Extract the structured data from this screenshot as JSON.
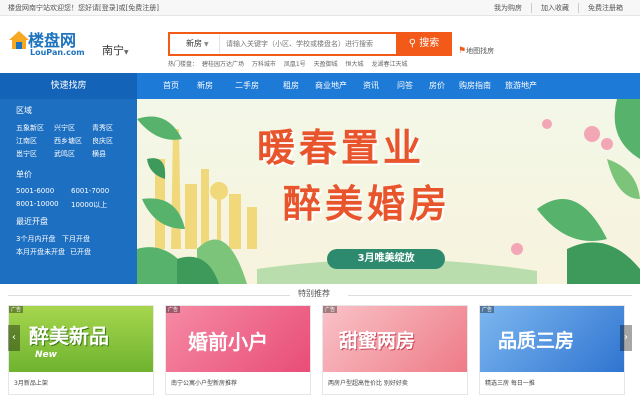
{
  "topbar": {
    "welcome": "楼盘网南宁站欢迎您！",
    "login": "您好请[登录]或[免费注册]",
    "links": [
      "我为购房",
      "加入收藏",
      "免费注册箱"
    ]
  },
  "header": {
    "logo_cn": "楼盘网",
    "logo_en": "LouPan.com",
    "city": "南宁",
    "search_type": "新房",
    "search_placeholder": "请输入关键字（小区、学校或楼盘名）进行搜索",
    "search_button": "搜索",
    "hot_label": "热门楼盘：",
    "hot_words": [
      "碧桂园万达广场",
      "万科城市",
      "凤凰1号",
      "天盈御城",
      "恒大城",
      "龙湖春江天城"
    ],
    "map_find": "地图找房"
  },
  "nav": {
    "quick": "快速找房",
    "items": [
      "首页",
      "新房",
      "二手房",
      "租房",
      "商业地产",
      "资讯",
      "问答",
      "房价",
      "购房指南",
      "旅游地产"
    ]
  },
  "panel": {
    "region_title": "区域",
    "regions": [
      [
        "五象新区",
        "兴宁区",
        "青秀区"
      ],
      [
        "江南区",
        "西乡塘区",
        "良庆区"
      ],
      [
        "邕宁区",
        "武鸣区",
        "横县"
      ]
    ],
    "price_title": "单价",
    "prices": [
      [
        "5001-6000",
        "6001-7000"
      ],
      [
        "8001-10000",
        "10000以上"
      ]
    ],
    "open_title": "最近开盘",
    "opens": [
      [
        "3个月内开盘",
        "下月开盘"
      ],
      [
        "本月开盘",
        "未开盘",
        "已开盘"
      ]
    ]
  },
  "banner": {
    "title1": "暖春置业",
    "title2": "醉美婚房",
    "subtitle": "3月唯美绽放"
  },
  "recommend": {
    "title": "特别推荐",
    "cards": [
      {
        "ad": "广告",
        "big": "醉美新品",
        "tag": "New",
        "caption": "3月新品上架",
        "bg": "#8cc63f"
      },
      {
        "ad": "广告",
        "big": "婚前小户",
        "caption": "南宁公寓小户型新房推荐",
        "bg": "#f06a8a"
      },
      {
        "ad": "广告",
        "big": "甜蜜两房",
        "caption": "两房户型超高性价比 别好好卖",
        "bg": "#f2a0a6"
      },
      {
        "ad": "广告",
        "big": "品质三房",
        "caption": "精选三房 每日一推",
        "bg": "#4a90e2"
      }
    ]
  },
  "colors": {
    "brand_blue": "#1d7ad7",
    "accent_orange": "#f35a1a"
  }
}
